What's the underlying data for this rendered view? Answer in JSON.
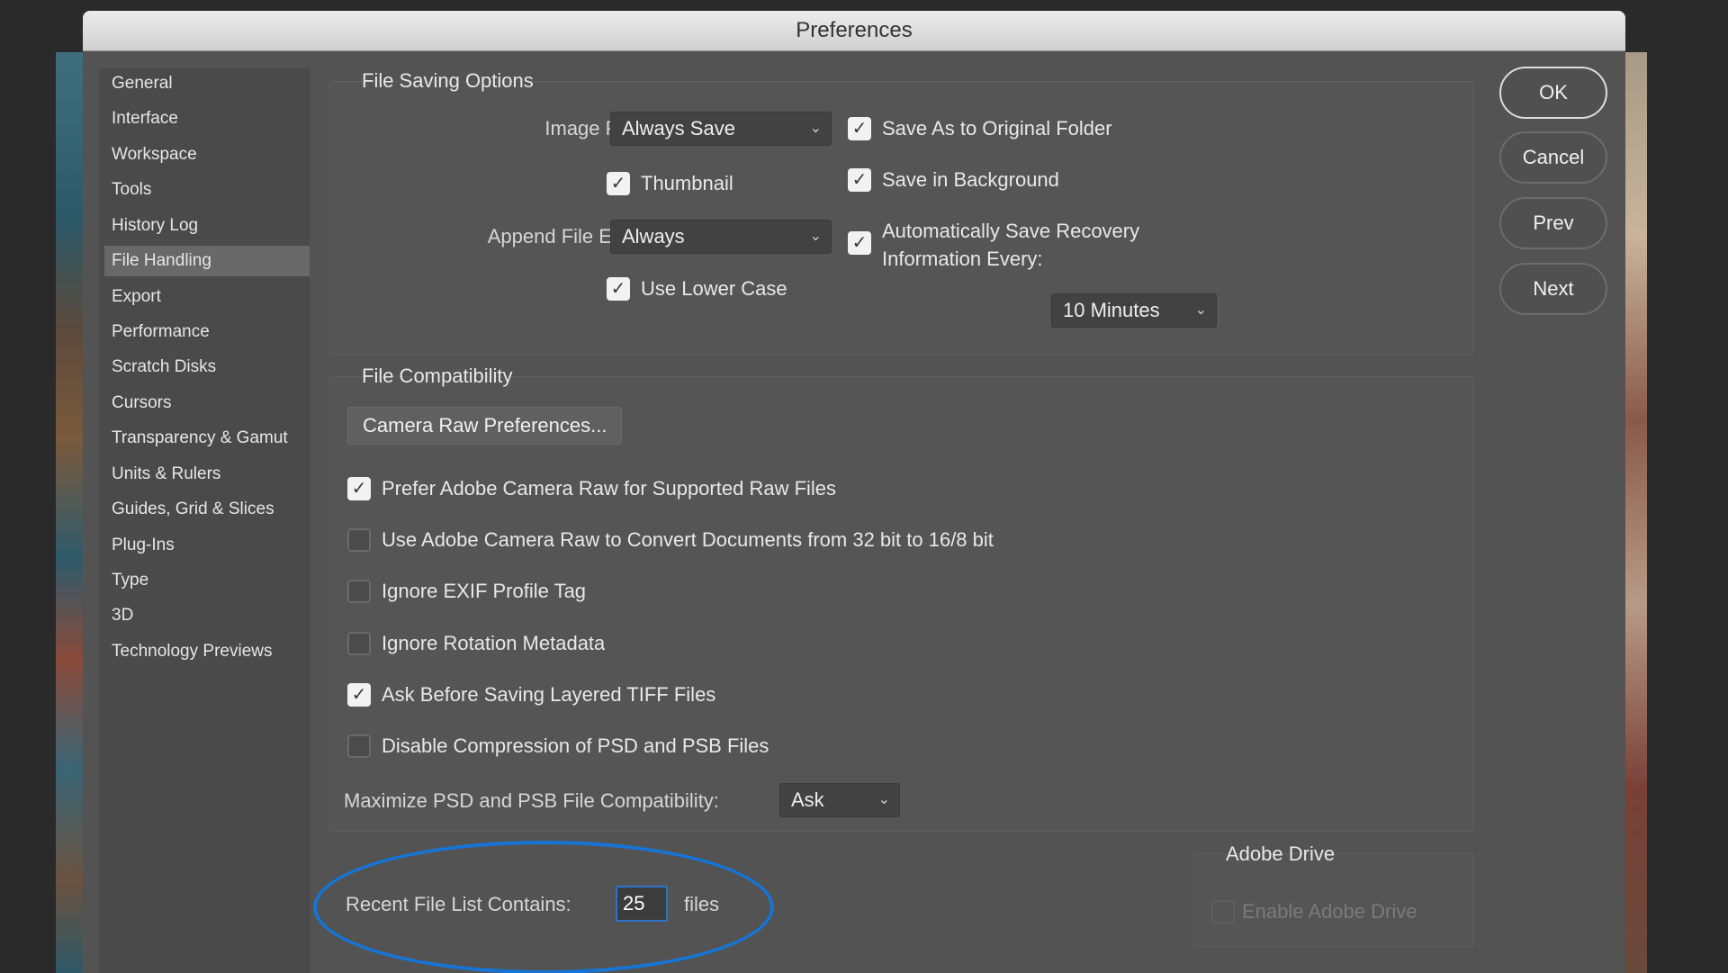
{
  "window": {
    "title": "Preferences"
  },
  "sidebar": {
    "items": [
      {
        "label": "General"
      },
      {
        "label": "Interface"
      },
      {
        "label": "Workspace"
      },
      {
        "label": "Tools"
      },
      {
        "label": "History Log"
      },
      {
        "label": "File Handling",
        "selected": true
      },
      {
        "label": "Export"
      },
      {
        "label": "Performance"
      },
      {
        "label": "Scratch Disks"
      },
      {
        "label": "Cursors"
      },
      {
        "label": "Transparency & Gamut"
      },
      {
        "label": "Units & Rulers"
      },
      {
        "label": "Guides, Grid & Slices"
      },
      {
        "label": "Plug-Ins"
      },
      {
        "label": "Type"
      },
      {
        "label": "3D"
      },
      {
        "label": "Technology Previews"
      }
    ]
  },
  "buttons": {
    "ok": "OK",
    "cancel": "Cancel",
    "prev": "Prev",
    "next": "Next"
  },
  "file_saving": {
    "legend": "File Saving Options",
    "image_previews_label": "Image Previews:",
    "image_previews_value": "Always Save",
    "thumbnail": {
      "label": "Thumbnail",
      "checked": true
    },
    "append_ext_label": "Append File Extension:",
    "append_ext_value": "Always",
    "use_lower_case": {
      "label": "Use Lower Case",
      "checked": true
    },
    "save_as_original": {
      "label": "Save As to Original Folder",
      "checked": true
    },
    "save_in_background": {
      "label": "Save in Background",
      "checked": true
    },
    "auto_save_line1": "Automatically Save Recovery",
    "auto_save_line2": "Information Every:",
    "auto_save_checked": true,
    "auto_save_interval": "10 Minutes"
  },
  "file_compat": {
    "legend": "File Compatibility",
    "camera_raw_button": "Camera Raw Preferences...",
    "options": [
      {
        "label": "Prefer Adobe Camera Raw for Supported Raw Files",
        "checked": true
      },
      {
        "label": "Use Adobe Camera Raw to Convert Documents from 32 bit to 16/8 bit",
        "checked": false
      },
      {
        "label": "Ignore EXIF Profile Tag",
        "checked": false
      },
      {
        "label": "Ignore Rotation Metadata",
        "checked": false
      },
      {
        "label": "Ask Before Saving Layered TIFF Files",
        "checked": true
      },
      {
        "label": "Disable Compression of PSD and PSB Files",
        "checked": false
      }
    ],
    "maximize_label": "Maximize PSD and PSB File Compatibility:",
    "maximize_value": "Ask"
  },
  "recent_files": {
    "label": "Recent File List Contains:",
    "value": "25",
    "suffix": "files"
  },
  "adobe_drive": {
    "legend": "Adobe Drive",
    "enable_label": "Enable Adobe Drive",
    "checked": false,
    "disabled": true
  },
  "colors": {
    "highlight_ellipse": "#1574d4",
    "field_focus": "#2f73c9"
  },
  "icons": {
    "dropdown": "chevron-down-icon",
    "checkbox_checked": "checkmark-icon"
  }
}
